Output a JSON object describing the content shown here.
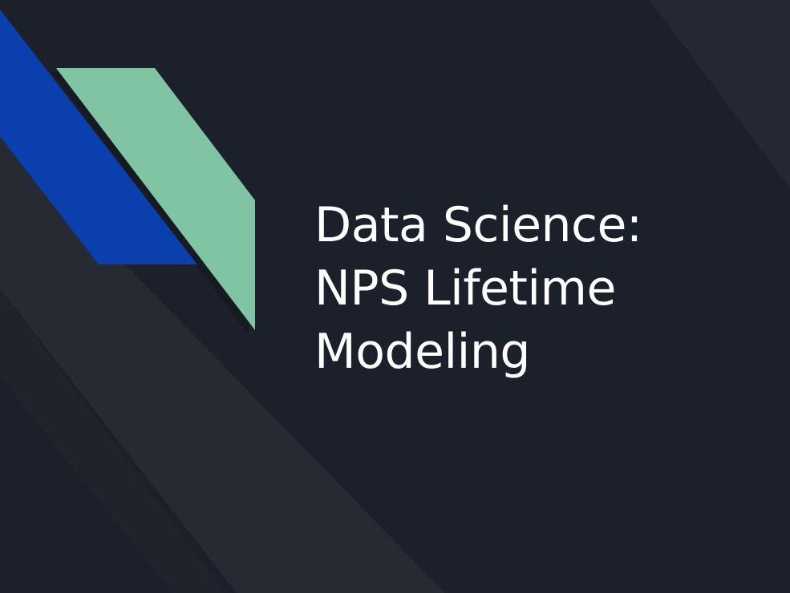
{
  "slide": {
    "title_lines": [
      "Data Science:",
      "NPS Lifetime",
      "Modeling"
    ]
  },
  "colors": {
    "background": "#1c202a",
    "stripe_dark": "#262b34",
    "accent_blue": "#0a3fad",
    "accent_green": "#80c4a4"
  }
}
